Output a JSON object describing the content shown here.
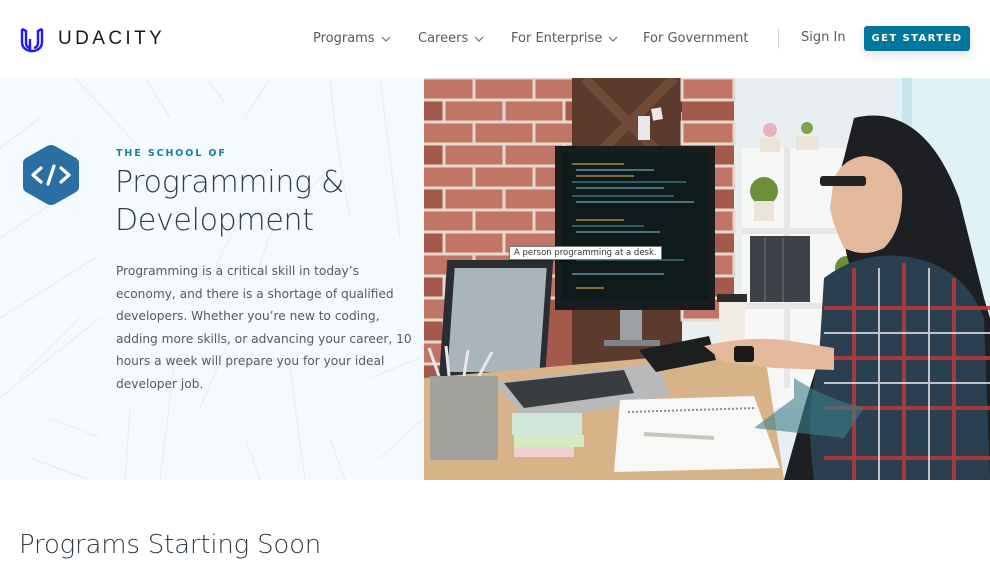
{
  "brand": {
    "name": "UDACITY",
    "logo_icon": "udacity-u-logo",
    "logo_color": "#2015ff"
  },
  "nav": {
    "items": [
      {
        "label": "Programs",
        "has_dropdown": true
      },
      {
        "label": "Careers",
        "has_dropdown": true
      },
      {
        "label": "For Enterprise",
        "has_dropdown": true
      },
      {
        "label": "For Government",
        "has_dropdown": false
      }
    ],
    "sign_in": "Sign In",
    "cta": "GET STARTED",
    "cta_color": "#02779e"
  },
  "hero": {
    "icon": "code-brackets-icon",
    "icon_color": "#2b6ea2",
    "eyebrow": "THE SCHOOL OF",
    "title_line1": "Programming &",
    "title_line2": "Development",
    "description": "Programming is a critical skill in today’s economy, and there is a shortage of qualified developers. Whether you’re new to coding, adding more skills, or advancing your career, 10 hours a week will prepare you for your ideal developer job.",
    "image_alt": "A person programming at a desk.",
    "tooltip": "A person programming at a desk."
  },
  "programs_section": {
    "title": "Programs Starting Soon"
  }
}
